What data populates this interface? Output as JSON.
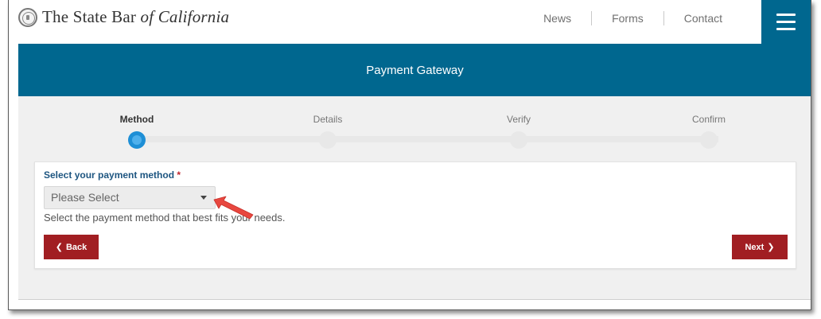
{
  "header": {
    "logo_prefix": "The State Bar",
    "logo_italic": "of California",
    "nav": [
      "News",
      "Forms",
      "Contact"
    ]
  },
  "banner": {
    "title": "Payment Gateway"
  },
  "steps": [
    {
      "label": "Method",
      "active": true
    },
    {
      "label": "Details",
      "active": false
    },
    {
      "label": "Verify",
      "active": false
    },
    {
      "label": "Confirm",
      "active": false
    }
  ],
  "form": {
    "label": "Select your payment method",
    "required_mark": "*",
    "select_value": "Please Select",
    "help": "Select the payment method that best fits your needs."
  },
  "buttons": {
    "back": "Back",
    "next": "Next"
  },
  "colors": {
    "brand_blue": "#00678f",
    "button_red": "#a11e22",
    "active_step": "#1e8fd6",
    "arrow_red": "#e8473f"
  },
  "icons": [
    "state-bar-seal-icon",
    "hamburger-menu-icon",
    "chevron-left-icon",
    "chevron-right-icon",
    "dropdown-caret-icon"
  ]
}
